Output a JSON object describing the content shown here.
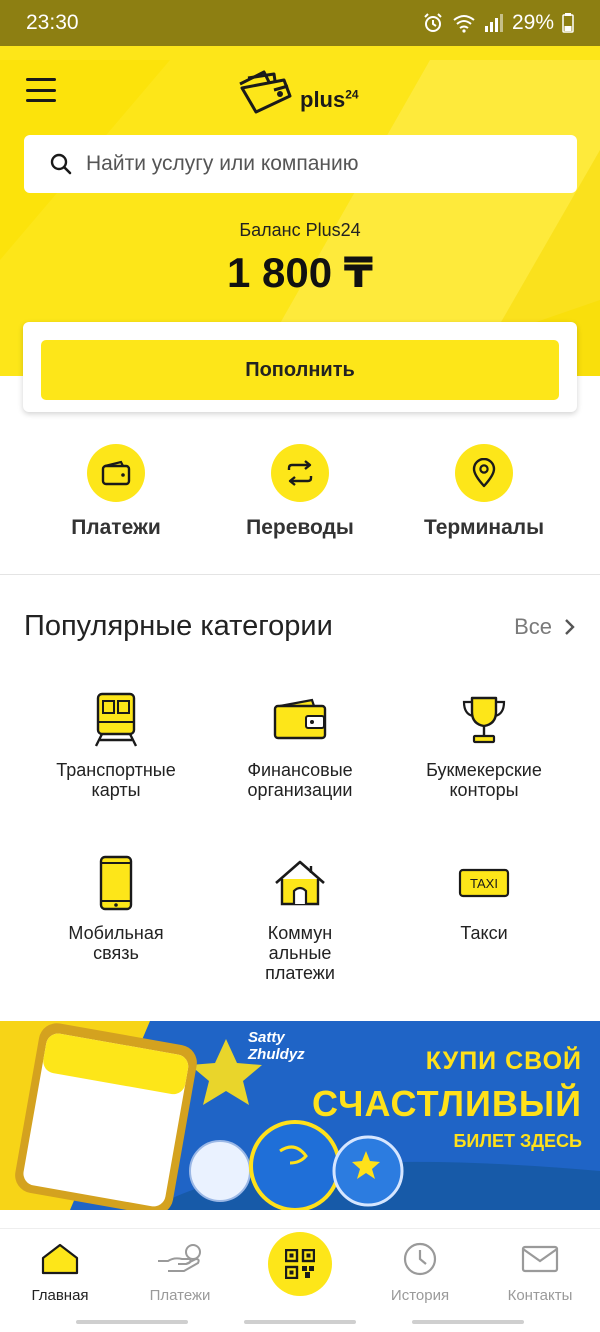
{
  "status_bar": {
    "time": "23:30",
    "battery": "29%"
  },
  "app": {
    "logo_text": "plus",
    "logo_sup": "24"
  },
  "search": {
    "placeholder": "Найти услугу или компанию"
  },
  "balance": {
    "label": "Баланс Plus24",
    "value": "1 800 ₸"
  },
  "topup": {
    "label": "Пополнить"
  },
  "quick_actions": [
    {
      "label": "Платежи",
      "icon": "wallet-icon"
    },
    {
      "label": "Переводы",
      "icon": "transfer-icon"
    },
    {
      "label": "Терминалы",
      "icon": "location-pin-icon"
    }
  ],
  "categories": {
    "title": "Популярные категории",
    "all_label": "Все",
    "items": [
      {
        "line1": "Транспортные",
        "line2": "карты",
        "line3": "",
        "icon": "train-icon"
      },
      {
        "line1": "Финансовые",
        "line2": "организации",
        "line3": "",
        "icon": "wallet-icon"
      },
      {
        "line1": "Букмекерские",
        "line2": "конторы",
        "line3": "",
        "icon": "trophy-icon"
      },
      {
        "line1": "Мобильная",
        "line2": "связь",
        "line3": "",
        "icon": "phone-icon"
      },
      {
        "line1": "Коммун",
        "line2": "альные",
        "line3": "платежи",
        "icon": "house-icon"
      },
      {
        "line1": "Такси",
        "line2": "",
        "line3": "",
        "icon": "taxi-icon"
      }
    ]
  },
  "banner": {
    "brand_line1": "Satty",
    "brand_line2": "Zhuldyz",
    "promo_line1": "КУПИ СВОЙ",
    "promo_line2": "СЧАСТЛИВЫЙ",
    "promo_line3": "БИЛЕТ ЗДЕСЬ"
  },
  "bottom_nav": [
    {
      "label": "Главная",
      "icon": "home-icon",
      "active": true
    },
    {
      "label": "Платежи",
      "icon": "hand-coin-icon",
      "active": false
    },
    {
      "label": "",
      "icon": "qr-code-icon",
      "active": false
    },
    {
      "label": "История",
      "icon": "clock-icon",
      "active": false
    },
    {
      "label": "Контакты",
      "icon": "mail-icon",
      "active": false
    }
  ],
  "colors": {
    "accent": "#fde619",
    "status_bar": "#8d7f12",
    "banner": "#1f64c6",
    "promo_text": "#ffe11a"
  }
}
